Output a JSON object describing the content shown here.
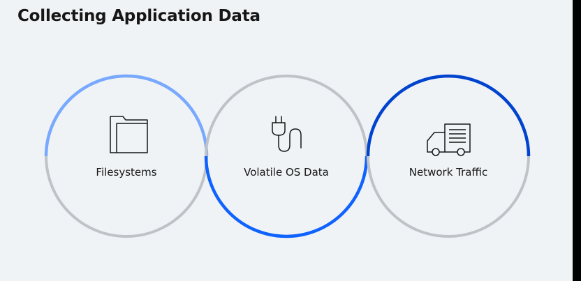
{
  "title": "Collecting Application Data",
  "colors": {
    "background": "#f0f3f6",
    "ring_gray": "#bfc3c8",
    "accent_light_blue": "#78a9ff",
    "accent_blue": "#0f62fe",
    "accent_dark_blue": "#0043ce"
  },
  "items": [
    {
      "label": "Filesystems",
      "icon": "folder-icon"
    },
    {
      "label": "Volatile OS Data",
      "icon": "plug-icon"
    },
    {
      "label": "Network Traffic",
      "icon": "truck-icon"
    }
  ]
}
